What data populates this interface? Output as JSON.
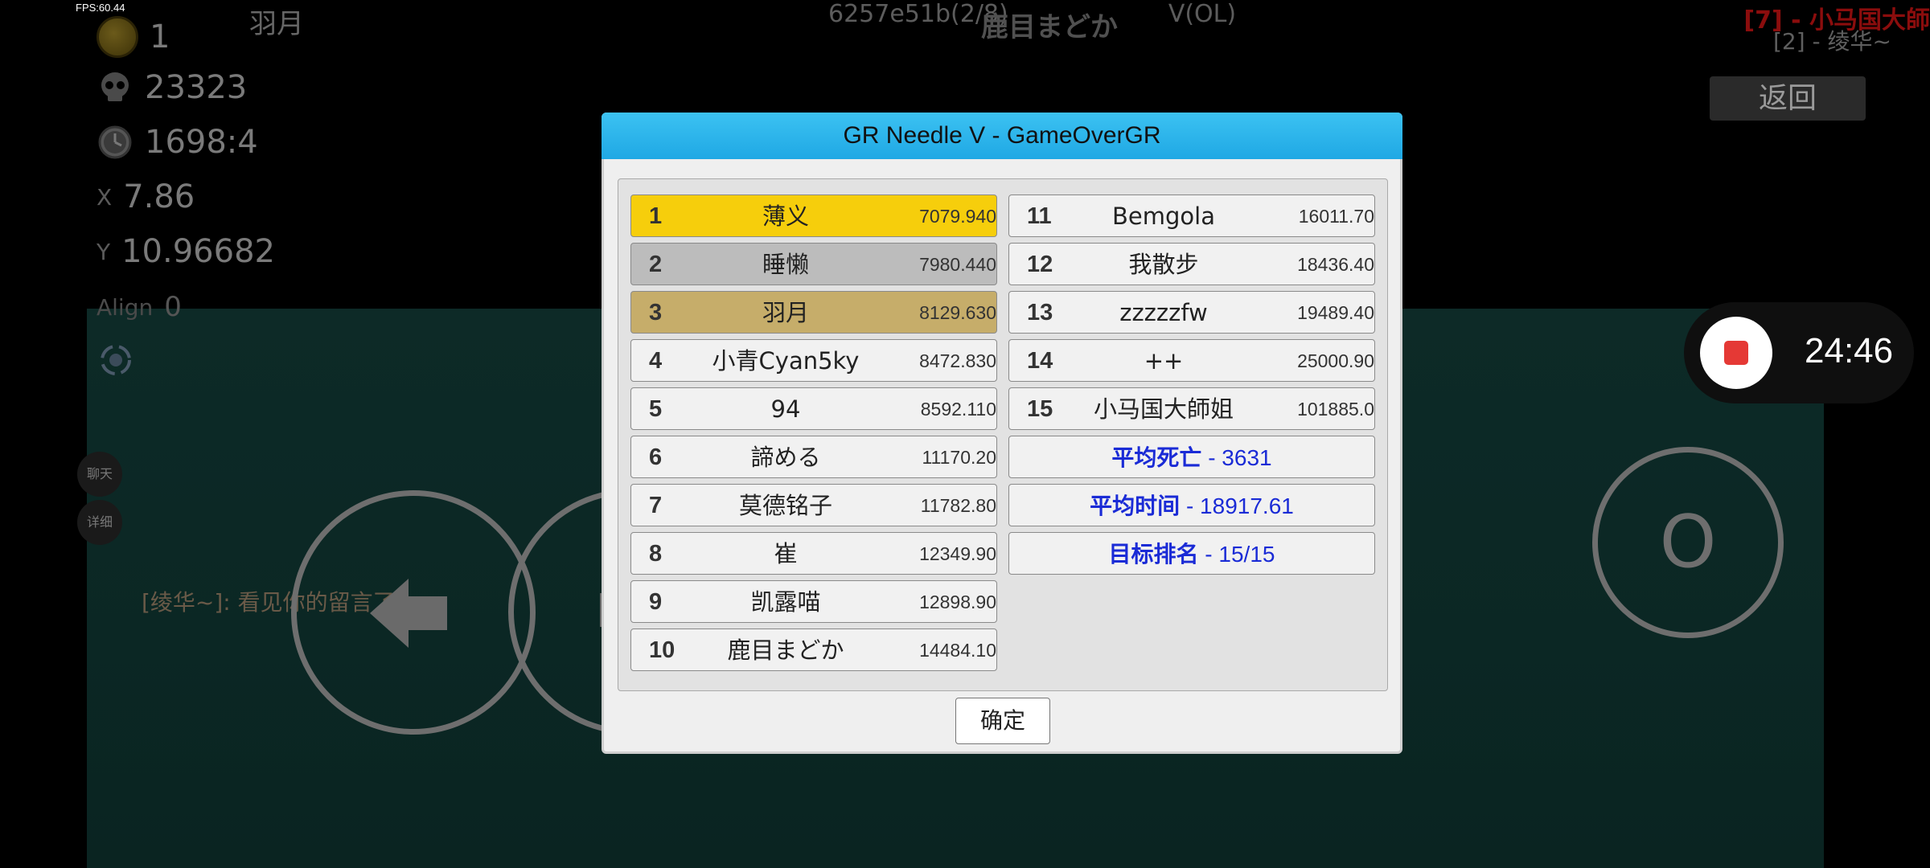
{
  "hud": {
    "fps": "FPS:60.44",
    "coins": "1",
    "deaths": "23323",
    "time": "1698:4",
    "x_label": "X",
    "x_value": "7.86",
    "y_label": "Y",
    "y_value": "10.96682",
    "align_label": "Align",
    "align_value": "0"
  },
  "top": {
    "player_name": "羽月",
    "room_line": "6257e51b(2/8)",
    "room_overlay": "鹿目まどか",
    "room_tail": "V(OL)",
    "right_line1": "[7] - 小马国大師",
    "right_line2": "[2] - 绫华~",
    "back_label": "返回"
  },
  "side": {
    "chat_btn": "聊天",
    "detail_btn": "详细",
    "chat_message": "[绫华~]: 看见你的留言了"
  },
  "controls": {
    "action_label": "O"
  },
  "recorder": {
    "time": "24:46"
  },
  "dialog": {
    "title": "GR Needle V - GameOverGR",
    "ok_label": "确定",
    "left_rows": [
      {
        "rank": "1",
        "name": "薄义",
        "score": "7079.940"
      },
      {
        "rank": "2",
        "name": "睡懒",
        "score": "7980.440"
      },
      {
        "rank": "3",
        "name": "羽月",
        "score": "8129.630"
      },
      {
        "rank": "4",
        "name": "小青Cyan5ky",
        "score": "8472.830"
      },
      {
        "rank": "5",
        "name": "94",
        "score": "8592.110"
      },
      {
        "rank": "6",
        "name": "諦める",
        "score": "11170.20"
      },
      {
        "rank": "7",
        "name": "莫德铭子",
        "score": "11782.80"
      },
      {
        "rank": "8",
        "name": "崔",
        "score": "12349.90"
      },
      {
        "rank": "9",
        "name": "凯露喵",
        "score": "12898.90"
      },
      {
        "rank": "10",
        "name": "鹿目まどか",
        "score": "14484.10"
      }
    ],
    "right_rows": [
      {
        "rank": "11",
        "name": "Bemgola",
        "score": "16011.70"
      },
      {
        "rank": "12",
        "name": "我散步",
        "score": "18436.40"
      },
      {
        "rank": "13",
        "name": "zzzzzfw",
        "score": "19489.40"
      },
      {
        "rank": "14",
        "name": "++",
        "score": "25000.90"
      },
      {
        "rank": "15",
        "name": "小马国大師姐",
        "score": "101885.0"
      }
    ],
    "stats": [
      {
        "label": "平均死亡",
        "value": " - 3631"
      },
      {
        "label": "平均时间",
        "value": " - 18917.61"
      },
      {
        "label": "目标排名",
        "value": " - 15/15"
      }
    ]
  },
  "colors": {
    "title_bar": "#1fa8e4",
    "gold": "#f6ce0c",
    "silver": "#bcbcbc",
    "bronze": "#c6ad6a",
    "stat_text": "#1a2bd6",
    "record_red": "#e53935"
  }
}
